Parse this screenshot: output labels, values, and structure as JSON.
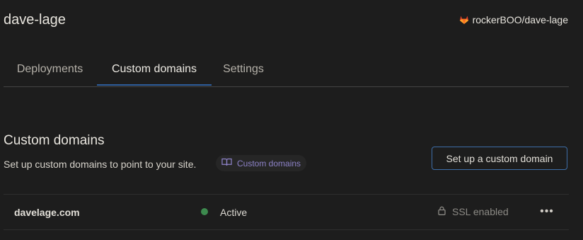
{
  "header": {
    "title": "dave-lage",
    "repo": "rockerBOO/dave-lage",
    "repo_icon": "gitlab-icon"
  },
  "tabs": [
    {
      "label": "Deployments",
      "active": false
    },
    {
      "label": "Custom domains",
      "active": true
    },
    {
      "label": "Settings",
      "active": false
    }
  ],
  "section": {
    "heading": "Custom domains",
    "description": "Set up custom domains to point to your site.",
    "doc_link_label": "Custom domains",
    "doc_link_icon": "book-icon",
    "cta_label": "Set up a custom domain"
  },
  "domains": [
    {
      "name": "davelage.com",
      "status": "Active",
      "status_color": "#3d8a4e",
      "ssl": "SSL enabled",
      "ssl_icon": "lock-icon",
      "menu_icon": "more-icon"
    }
  ],
  "colors": {
    "background": "#1d1d1d",
    "accent": "#2f5f9d",
    "doc_link": "#8e83c9",
    "gitlab_orange": "#e2432a"
  }
}
